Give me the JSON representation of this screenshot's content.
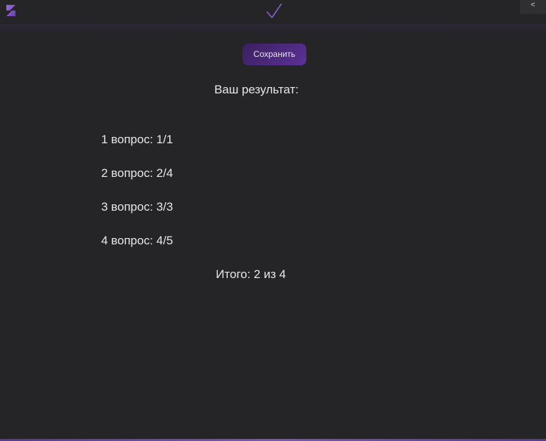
{
  "header": {
    "logo_icon": "z-logo-icon",
    "center_icon": "checkmark-icon",
    "back_label": "<"
  },
  "actions": {
    "save_label": "Сохранить"
  },
  "results": {
    "title": "Ваш результат:",
    "questions": [
      "1 вопрос: 1/1",
      "2 вопрос: 2/4",
      "3 вопрос: 3/3",
      "4 вопрос: 4/5"
    ],
    "total": "Итого: 2 из 4"
  },
  "colors": {
    "background": "#252427",
    "accent": "#5b3296",
    "text": "#e8e8e8"
  }
}
